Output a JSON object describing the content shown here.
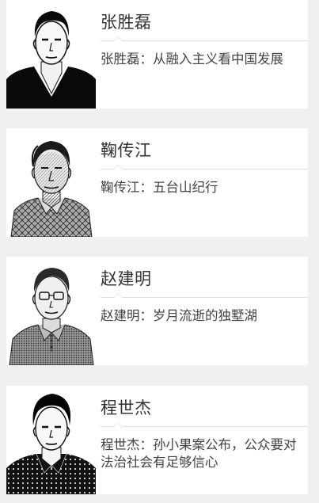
{
  "items": [
    {
      "name": "张胜磊",
      "headline": "张胜磊：从融入主义看中国发展",
      "portrait": "portrait-young-man-v-neck"
    },
    {
      "name": "鞠传江",
      "headline": "鞠传江：五台山纪行",
      "portrait": "portrait-older-man-plaid-shirt"
    },
    {
      "name": "赵建明",
      "headline": "赵建明：岁月流逝的独墅湖",
      "portrait": "portrait-man-glasses-polo"
    },
    {
      "name": "程世杰",
      "headline": "程世杰：孙小果案公布，公众要对法治社会有足够信心",
      "portrait": "portrait-young-man-patterned-shirt"
    }
  ]
}
